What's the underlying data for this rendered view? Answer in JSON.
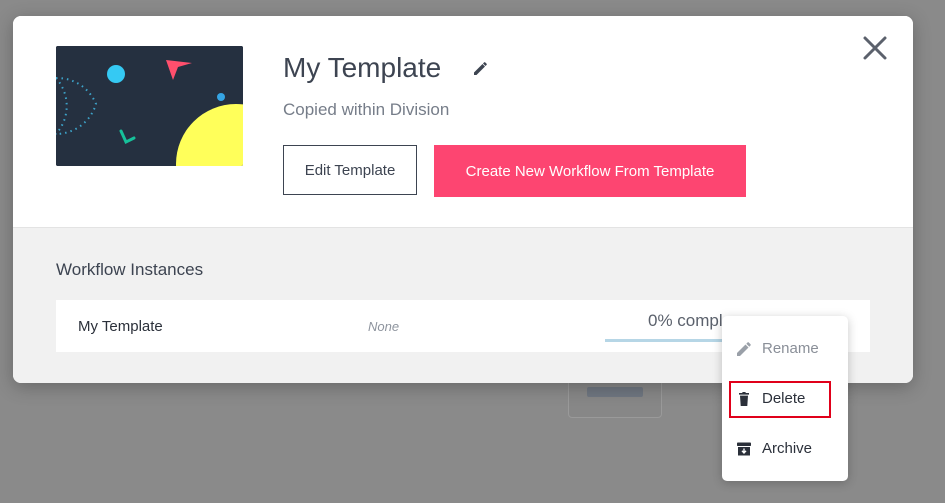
{
  "modal": {
    "title": "My Template",
    "subtitle": "Copied within Division",
    "edit_button": "Edit Template",
    "create_button": "Create New Workflow From Template"
  },
  "instances": {
    "section_title": "Workflow Instances",
    "rows": [
      {
        "name": "My Template",
        "status": "None",
        "progress_text": "0% compl",
        "progress_fraction": 0
      }
    ]
  },
  "context_menu": {
    "items": [
      {
        "label": "Rename",
        "icon": "pencil-icon",
        "enabled": false
      },
      {
        "label": "Delete",
        "icon": "trash-icon",
        "enabled": true,
        "highlighted": true
      },
      {
        "label": "Archive",
        "icon": "archive-icon",
        "enabled": true
      }
    ]
  },
  "colors": {
    "primary_pink": "#fd4571",
    "text_dark": "#3d4451",
    "thumbnail_bg": "#253040",
    "highlight_red": "#e0001a"
  }
}
